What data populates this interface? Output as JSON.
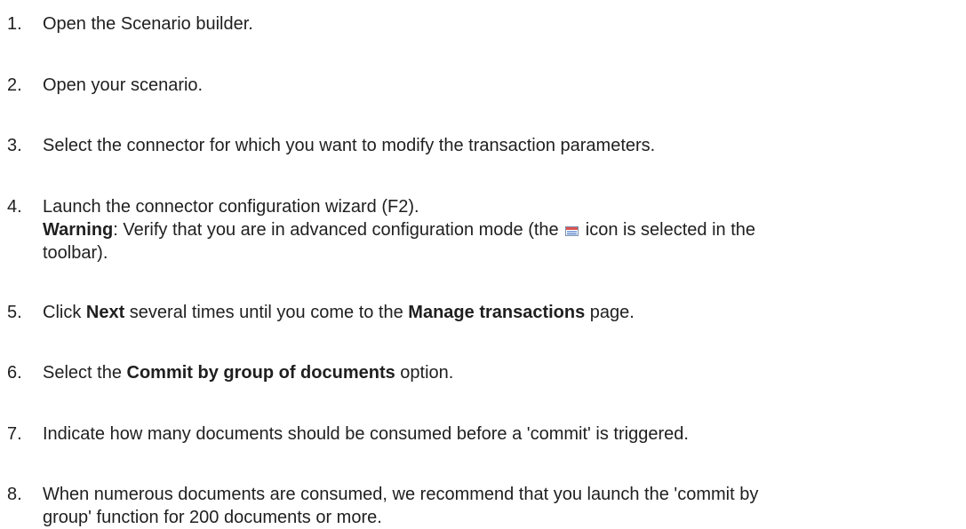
{
  "steps": [
    {
      "num": "1.",
      "text": "Open the Scenario builder."
    },
    {
      "num": "2.",
      "text": "Open your scenario."
    },
    {
      "num": "3.",
      "text": "Select the connector for which you want to modify the transaction parameters."
    },
    {
      "num": "4.",
      "text": "Launch the connector configuration wizard (F2).",
      "warning_label": "Warning",
      "warning_before": ": Verify that you are in advanced configuration mode (the ",
      "warning_icon": "advanced-mode-icon",
      "warning_after_line1": " icon is selected in the",
      "warning_after_line2": "toolbar)."
    },
    {
      "num": "5.",
      "pre": "Click ",
      "bold1": "Next",
      "mid": " several times until you come to the ",
      "bold2": "Manage transactions",
      "post": " page."
    },
    {
      "num": "6.",
      "pre": "Select the ",
      "bold1": "Commit by group of documents",
      "post": " option."
    },
    {
      "num": "7.",
      "text": "Indicate how many documents should be consumed before a 'commit' is triggered."
    },
    {
      "num": "8.",
      "line1": "When numerous documents are consumed, we recommend that you launch the 'commit by",
      "line2": "group' function for 200 documents or more."
    }
  ],
  "colors": {
    "text": "#1f1f1f",
    "icon_red": "#d9534f",
    "icon_blue": "#3a6fc4"
  }
}
